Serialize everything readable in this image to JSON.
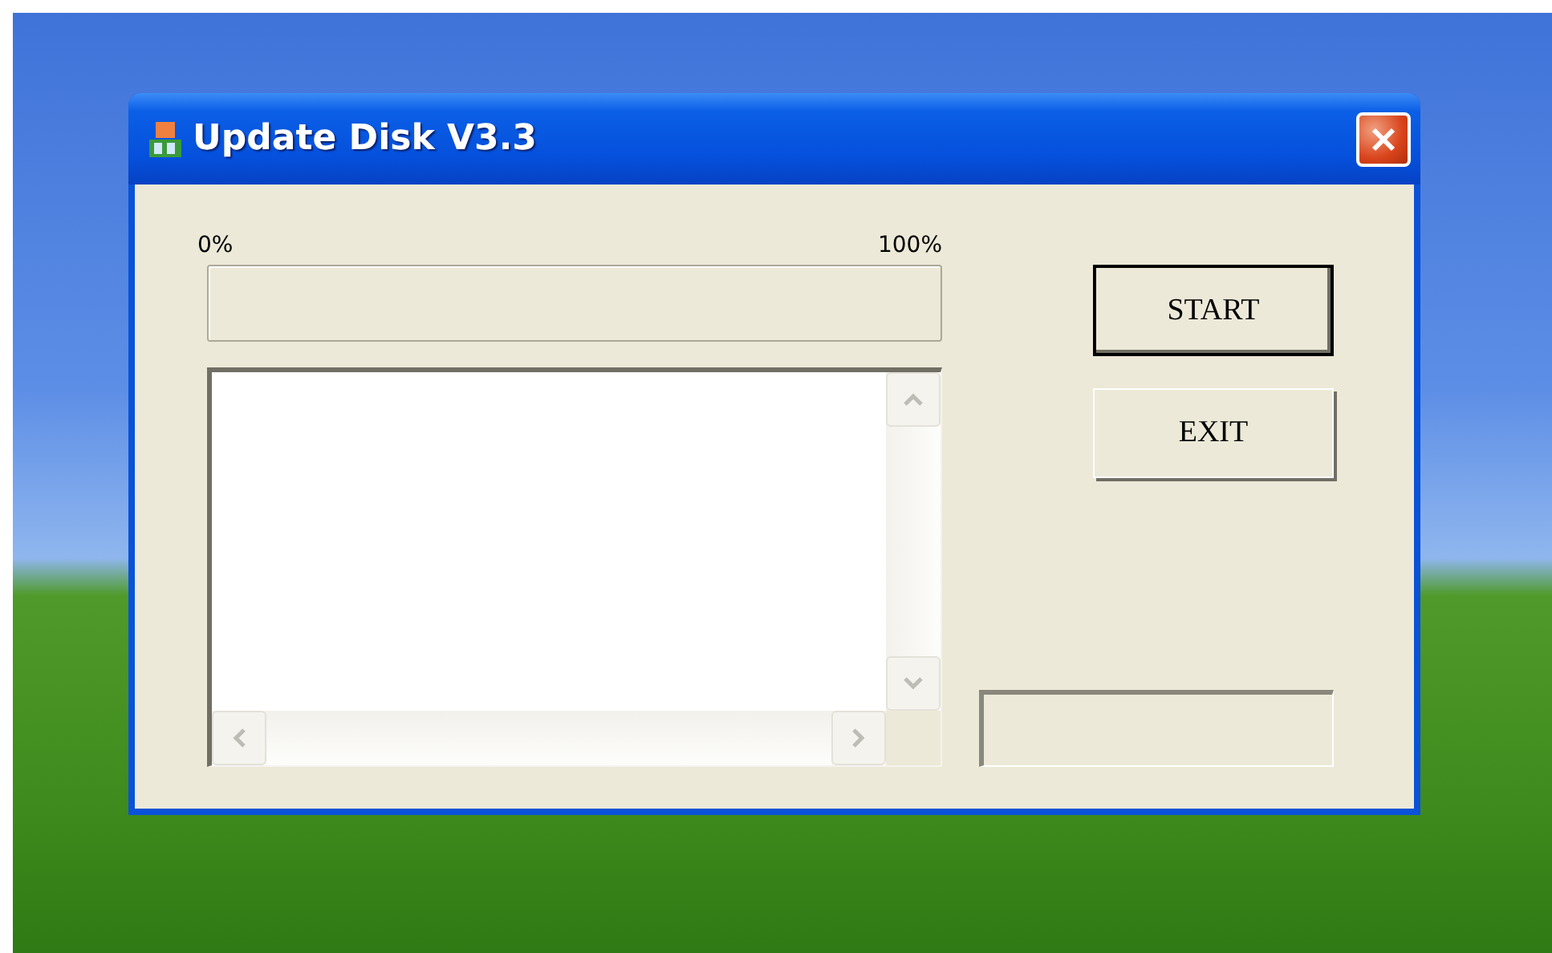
{
  "window": {
    "title": "Update Disk V3.3"
  },
  "progress": {
    "min_label": "0%",
    "max_label": "100%",
    "level": 0
  },
  "buttons": [
    {
      "label": "START",
      "default": true
    },
    {
      "label": "EXIT",
      "default": false
    }
  ]
}
